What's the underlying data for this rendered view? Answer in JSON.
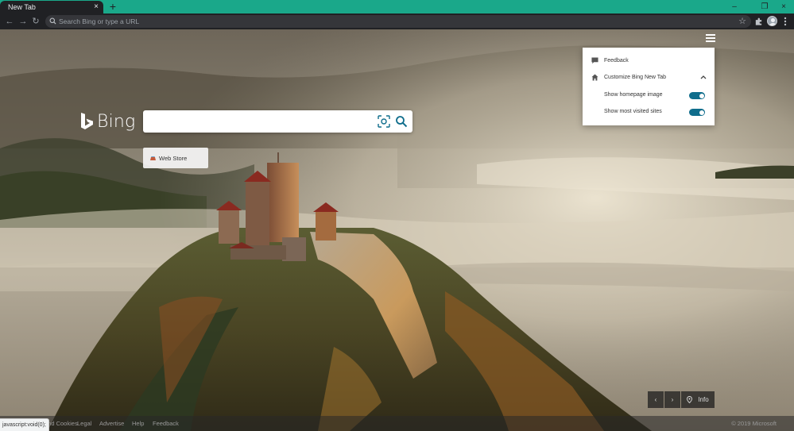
{
  "browser": {
    "tab_title": "New Tab",
    "tab_close_glyph": "×",
    "new_tab_glyph": "+",
    "window_controls": {
      "minimize": "–",
      "restore": "❐",
      "close": "×"
    },
    "nav": {
      "back": "←",
      "forward": "→",
      "reload": "↻"
    },
    "omnibox_placeholder": "Search Bing or type a URL",
    "toolbar_icons": [
      "star-icon",
      "extensions-icon",
      "profile-avatar",
      "more-menu-icon"
    ],
    "accent_color": "#1aa88a"
  },
  "bing": {
    "logo_text": "Bing",
    "search_value": "",
    "tiles": [
      {
        "label": "Web Store"
      }
    ]
  },
  "settings_panel": {
    "feedback_label": "Feedback",
    "customize_label": "Customize Bing New Tab",
    "options": [
      {
        "label": "Show homepage image",
        "enabled": true
      },
      {
        "label": "Show most visited sites",
        "enabled": true
      }
    ],
    "toggle_color": "#0f6d8c"
  },
  "image_nav": {
    "prev": "‹",
    "next": "›",
    "info_label": "Info"
  },
  "footer": {
    "links": [
      "and Cookies",
      "Legal",
      "Advertise",
      "Help",
      "Feedback"
    ],
    "copyright": "© 2019 Microsoft"
  },
  "status_bar_url": "javascript:void(0);"
}
